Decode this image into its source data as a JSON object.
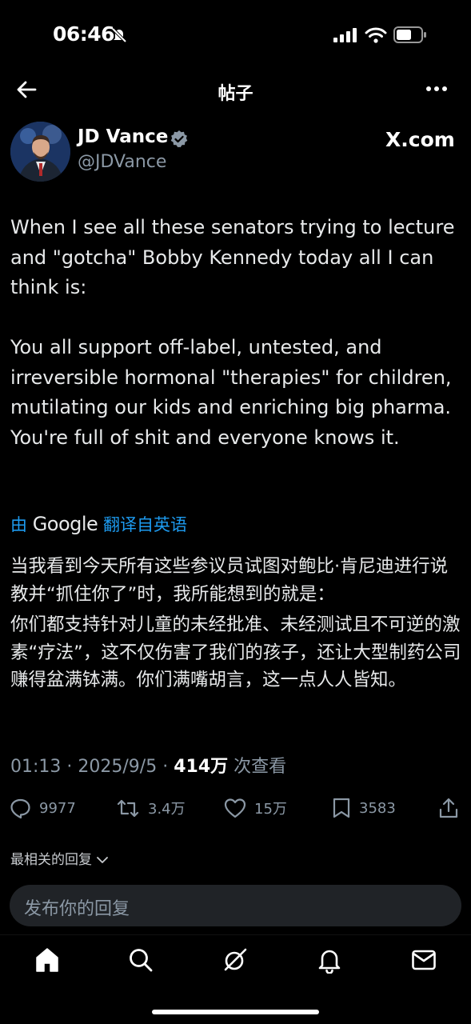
{
  "status_bar": {
    "time": "06:46"
  },
  "header": {
    "title": "帖子"
  },
  "author": {
    "name": "JD Vance",
    "handle": "@JDVance",
    "verified": true
  },
  "source_label": "X.com",
  "tweet": {
    "paragraphs": [
      "When I see all these senators trying to lecture and \"gotcha\" Bobby Kennedy today all I can think is:",
      "You all support off-label, untested, and irreversible hormonal \"therapies\" for children, mutilating our kids and enriching big pharma. You're full of shit and everyone knows it."
    ]
  },
  "translation": {
    "prefix": "由",
    "provider": "Google",
    "suffix": "翻译自英语",
    "paragraphs": [
      "当我看到今天所有这些参议员试图对鲍比·肯尼迪进行说教并“抓住你了”时，我所能想到的就是：",
      "你们都支持针对儿童的未经批准、未经测试且不可逆的激素“疗法”，这不仅伤害了我们的孩子，还让大型制药公司赚得盆满钵满。你们满嘴胡言，这一点人人皆知。"
    ]
  },
  "meta": {
    "time": "01:13",
    "date": "2025/9/5",
    "views": "414万",
    "views_label": "次查看",
    "sep": "·"
  },
  "actions": {
    "replies": "9977",
    "reposts": "3.4万",
    "likes": "15万",
    "bookmarks": "3583"
  },
  "related_label": "最相关的回复",
  "reply": {
    "placeholder": "发布你的回复"
  },
  "icons": [
    "back-arrow-icon",
    "more-icon",
    "verified-badge-icon",
    "reply-icon",
    "repost-icon",
    "like-icon",
    "bookmark-icon",
    "share-icon",
    "home-icon",
    "search-icon",
    "grok-icon",
    "notifications-icon",
    "messages-icon"
  ]
}
